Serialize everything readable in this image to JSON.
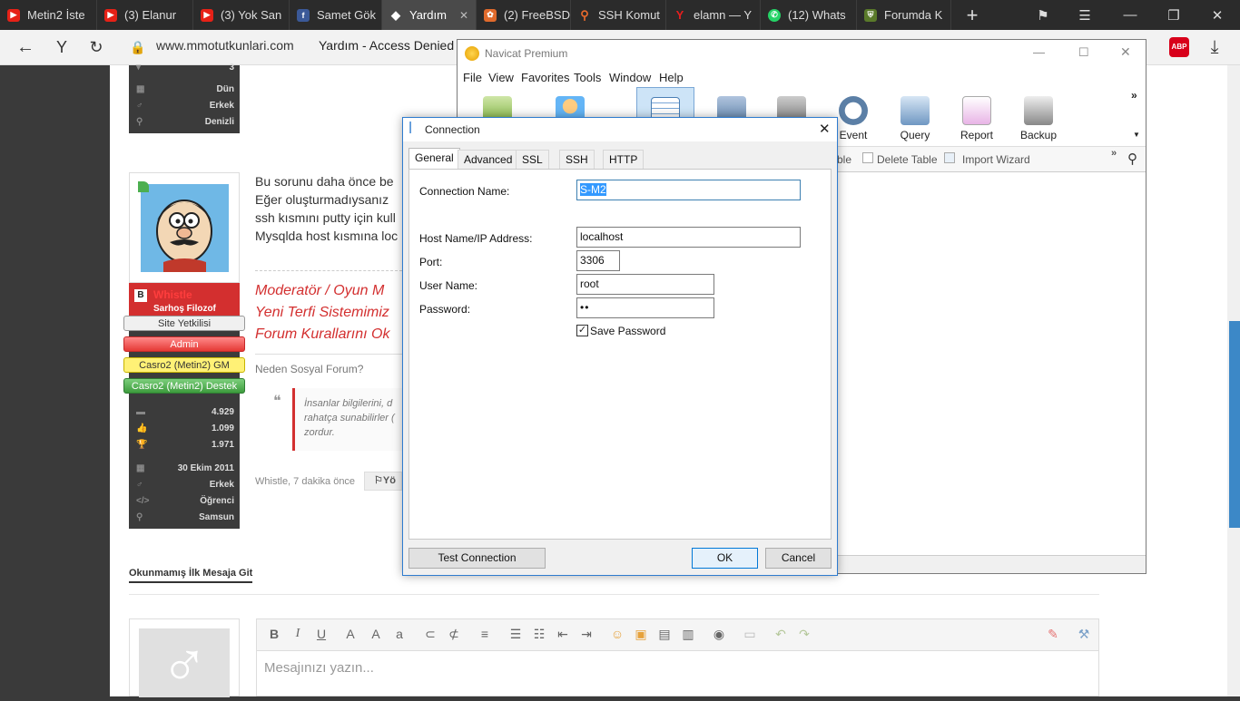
{
  "browser": {
    "tabs": [
      {
        "label": "Metin2 İste",
        "icon": "youtube-icon",
        "color": "#e62117"
      },
      {
        "label": "(3) Elanur",
        "icon": "youtube-icon",
        "color": "#e62117"
      },
      {
        "label": "(3) Yok San",
        "icon": "youtube-icon",
        "color": "#e62117"
      },
      {
        "label": "Samet Gök",
        "icon": "facebook-icon",
        "color": "#3b5998"
      },
      {
        "label": "Yardım",
        "icon": "forum-icon",
        "color": "#ffffff"
      },
      {
        "label": "(2) FreeBSD",
        "icon": "freebsd-icon",
        "color": "#e06a2c"
      },
      {
        "label": "SSH Komut",
        "icon": "search-icon",
        "color": "#e86a2c"
      },
      {
        "label": "elamn — Y",
        "icon": "yandex-icon",
        "color": "#e61e1e"
      },
      {
        "label": "(12) Whats",
        "icon": "whatsapp-icon",
        "color": "#25d366"
      },
      {
        "label": "Forumda K",
        "icon": "shield-icon",
        "color": "#5a7a2a"
      }
    ],
    "url": "www.mmotutkunlari.com",
    "page_title": "Yardım - Access Denied",
    "adblock": "ABP"
  },
  "profile_top": {
    "rows": [
      "3",
      "Dün",
      "Erkek",
      "Denizli"
    ]
  },
  "post": {
    "lines": [
      "Bu sorunu daha önce be",
      "Eğer oluşturmadıysanız",
      "ssh kısmını putty için kull",
      "Mysqlda host kısmına loc"
    ],
    "signature": [
      "Moderatör / Oyun M",
      "Yeni Terfi Sistemimiz",
      "Forum Kurallarını Ok"
    ],
    "social": "Neden Sosyal Forum?",
    "quote": [
      "İnsanlar bilgilerini, d",
      "rahatça sunabilirler (",
      "zordur."
    ],
    "footer_meta": "Whistle, 7 dakika önce",
    "reply_label": "Yö"
  },
  "user": {
    "name": "Whistle",
    "rank": "Sarhoş Filozof",
    "badges": [
      "Site Yetkilisi",
      "Admin",
      "Casro2 (Metin2) GM",
      "Casro2 (Metin2) Destek"
    ],
    "stats": [
      "4.929",
      "1.099",
      "1.971"
    ],
    "details": [
      "30 Ekim 2011",
      "Erkek",
      "Öğrenci",
      "Samsun"
    ]
  },
  "jump_link": "Okunmamış İlk Mesaja Git",
  "editor": {
    "placeholder": "Mesajınızı yazın..."
  },
  "navicat": {
    "title": "Navicat Premium",
    "menu": [
      "File",
      "View",
      "Favorites",
      "Tools",
      "Window",
      "Help"
    ],
    "toolbar": [
      "Event",
      "Query",
      "Report",
      "Backup"
    ],
    "subtoolbar": [
      "ble",
      "Delete Table",
      "Import Wizard"
    ]
  },
  "dialog": {
    "title": "Connection",
    "tabs": [
      "General",
      "Advanced",
      "SSL",
      "SSH",
      "HTTP"
    ],
    "fields": {
      "connection_name_label": "Connection Name:",
      "connection_name": "S-M2",
      "host_label": "Host Name/IP Address:",
      "host": "localhost",
      "port_label": "Port:",
      "port": "3306",
      "user_label": "User Name:",
      "user": "root",
      "password_label": "Password:",
      "password": "••",
      "save_password": "Save Password"
    },
    "buttons": {
      "test": "Test Connection",
      "ok": "OK",
      "cancel": "Cancel"
    }
  }
}
